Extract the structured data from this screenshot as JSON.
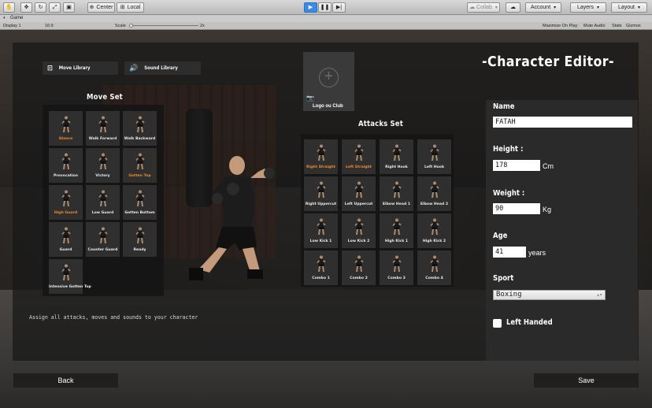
{
  "editor": {
    "toolbar": {
      "pivot_label": "Center",
      "space_label": "Local",
      "collab_label": "Collab",
      "account_label": "Account",
      "layers_label": "Layers",
      "layout_label": "Layout"
    },
    "game_view": {
      "tab_label": "Game",
      "display_label": "Display 1",
      "aspect_label": "16:9",
      "scale_label": "Scale",
      "scale_value": "2x",
      "options": [
        "Maximize On Play",
        "Mute Audio",
        "Stats",
        "Gizmos"
      ]
    }
  },
  "libraries": {
    "move_library_label": "Move Library",
    "sound_library_label": "Sound Library"
  },
  "move_set": {
    "title": "Move Set",
    "items": [
      {
        "label": "Stance",
        "highlight": true
      },
      {
        "label": "Walk Forward",
        "highlight": false
      },
      {
        "label": "Walk Backward",
        "highlight": false
      },
      {
        "label": "Provocation",
        "highlight": false
      },
      {
        "label": "Victory",
        "highlight": false
      },
      {
        "label": "Gotten Top",
        "highlight": true
      },
      {
        "label": "High Guard",
        "highlight": true
      },
      {
        "label": "Low Guard",
        "highlight": false
      },
      {
        "label": "Gotten Bottom",
        "highlight": false
      },
      {
        "label": "Guard",
        "highlight": false
      },
      {
        "label": "Counter Guard",
        "highlight": false
      },
      {
        "label": "Ready",
        "highlight": false
      },
      {
        "label": "Intensive Gotten Top",
        "highlight": false
      }
    ]
  },
  "hint": "Assign all attacks, moves and sounds to your character",
  "logo": {
    "label": "Logo ou Club"
  },
  "attacks_set": {
    "title": "Attacks Set",
    "items": [
      {
        "label": "Right Straight",
        "highlight": true
      },
      {
        "label": "Left Straight",
        "highlight": true
      },
      {
        "label": "Right Hook",
        "highlight": false
      },
      {
        "label": "Left Hook",
        "highlight": false
      },
      {
        "label": "Right Uppercut",
        "highlight": false
      },
      {
        "label": "Left Uppercut",
        "highlight": false
      },
      {
        "label": "Elbow Head 1",
        "highlight": false
      },
      {
        "label": "Elbow Head 2",
        "highlight": false
      },
      {
        "label": "Low Kick 1",
        "highlight": false
      },
      {
        "label": "Low Kick 2",
        "highlight": false
      },
      {
        "label": "High Kick 1",
        "highlight": false
      },
      {
        "label": "High Kick 2",
        "highlight": false
      },
      {
        "label": "Combo 1",
        "highlight": false
      },
      {
        "label": "Combo 2",
        "highlight": false
      },
      {
        "label": "Combo 3",
        "highlight": false
      },
      {
        "label": "Combo 4",
        "highlight": false
      }
    ]
  },
  "character": {
    "title": "-Character Editor-",
    "name_label": "Name",
    "name_value": "FATAH",
    "height_label": "Height :",
    "height_value": "178",
    "height_unit": "Cm",
    "weight_label": "Weight :",
    "weight_value": "90",
    "weight_unit": "Kg",
    "age_label": "Age",
    "age_value": "41",
    "age_unit": "years",
    "sport_label": "Sport",
    "sport_value": "Boxing",
    "left_handed_label": "Left Handed",
    "left_handed_checked": false
  },
  "buttons": {
    "back": "Back",
    "save": "Save"
  },
  "colors": {
    "highlight_label": "#ef8a2a",
    "play_active": "#3c8ae8"
  }
}
